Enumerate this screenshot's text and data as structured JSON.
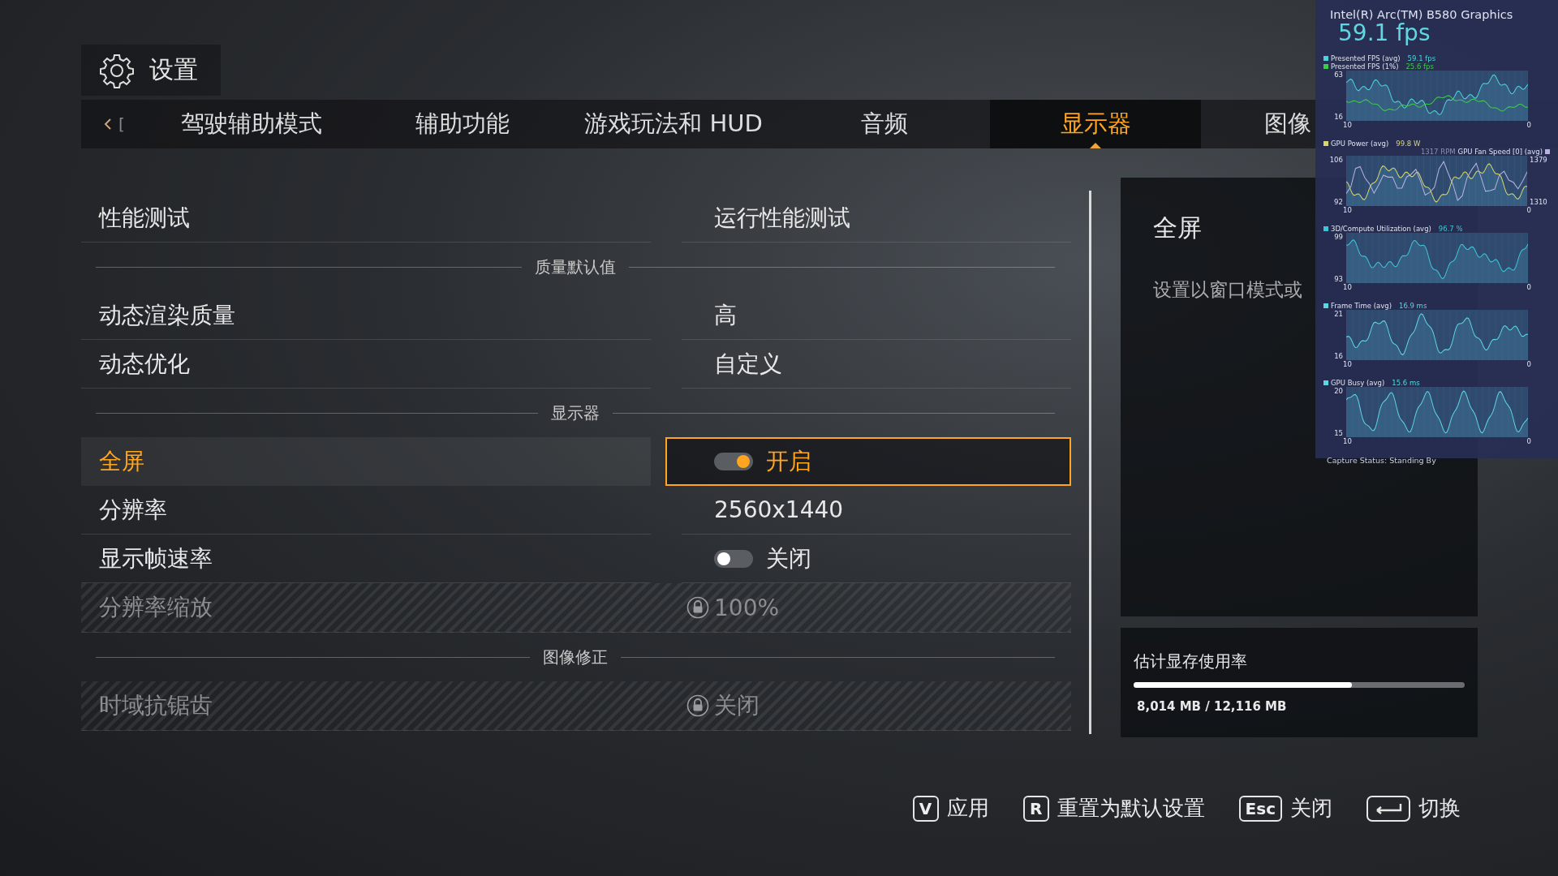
{
  "header": {
    "title": "设置"
  },
  "tabs": {
    "bumper": "[",
    "items": [
      {
        "label": "驾驶辅助模式",
        "selected": false
      },
      {
        "label": "辅助功能",
        "selected": false
      },
      {
        "label": "游戏玩法和 HUD",
        "selected": false
      },
      {
        "label": "音频",
        "selected": false
      },
      {
        "label": "显示器",
        "selected": true
      },
      {
        "label": "图像",
        "selected": false
      }
    ]
  },
  "settings": [
    {
      "kind": "text",
      "label": "性能测试",
      "value": "运行性能测试",
      "selected": false
    },
    {
      "kind": "section",
      "label": "质量默认值"
    },
    {
      "kind": "text",
      "label": "动态渲染质量",
      "value": "高",
      "selected": false
    },
    {
      "kind": "text",
      "label": "动态优化",
      "value": "自定义",
      "selected": false
    },
    {
      "kind": "section",
      "label": "显示器"
    },
    {
      "kind": "toggle",
      "label": "全屏",
      "value": "开启",
      "on": true,
      "selected": true
    },
    {
      "kind": "text",
      "label": "分辨率",
      "value": "2560x1440",
      "selected": false
    },
    {
      "kind": "toggle",
      "label": "显示帧速率",
      "value": "关闭",
      "on": false,
      "selected": false
    },
    {
      "kind": "locked",
      "label": "分辨率缩放",
      "value": "100%",
      "selected": false
    },
    {
      "kind": "section",
      "label": "图像修正"
    },
    {
      "kind": "locked",
      "label": "时域抗锯齿",
      "value": "关闭",
      "selected": false
    }
  ],
  "info_panel": {
    "title": "全屏",
    "description": "设置以窗口模式或"
  },
  "vram": {
    "label": "估计显存使用率",
    "level": 0.66,
    "reading": "8,014 MB / 12,116 MB"
  },
  "hints": [
    {
      "kind": "letter",
      "key": "V",
      "label": "应用"
    },
    {
      "kind": "letter",
      "key": "R",
      "label": "重置为默认设置"
    },
    {
      "kind": "letter",
      "key": "Esc",
      "label": "关闭"
    },
    {
      "kind": "enter",
      "label": "切换"
    }
  ],
  "overlay": {
    "gpu": "Intel(R) Arc(TM) B580 Graphics",
    "fps": "59.1 fps",
    "graphs": [
      {
        "legends": [
          {
            "name": "Presented FPS (avg)",
            "value": "59.1 fps",
            "color": "#4fd1d9"
          },
          {
            "name": "Presented FPS (1%)",
            "value": "25.6 fps",
            "color": "#3ec94a"
          }
        ],
        "y_ticks": [
          "63",
          "16"
        ],
        "x_ticks": [
          "10",
          "0"
        ]
      },
      {
        "legends": [
          {
            "name": "GPU Power (avg)",
            "value": "99.8 W",
            "color": "#d8d66c"
          }
        ],
        "right_legend": {
          "name": "GPU Fan Speed [0] (avg)",
          "value": "1317 RPM",
          "color": "#b9b2e0"
        },
        "y_ticks": [
          "106",
          "92"
        ],
        "right_ticks": [
          "1379",
          "1310"
        ],
        "x_ticks": [
          "10",
          "0"
        ]
      },
      {
        "legends": [
          {
            "name": "3D/Compute Utilization (avg)",
            "value": "96.7 %",
            "color": "#3fc4d6"
          }
        ],
        "y_ticks": [
          "99",
          "93"
        ],
        "x_ticks": [
          "10",
          "0"
        ]
      },
      {
        "legends": [
          {
            "name": "Frame Time (avg)",
            "value": "16.9 ms",
            "color": "#5ed6e0"
          }
        ],
        "y_ticks": [
          "21",
          "16"
        ],
        "x_ticks": [
          "10",
          "0"
        ]
      },
      {
        "legends": [
          {
            "name": "GPU Busy (avg)",
            "value": "15.6 ms",
            "color": "#5ed6e0"
          }
        ],
        "y_ticks": [
          "20",
          "15"
        ],
        "x_ticks": [
          "10",
          "0"
        ]
      }
    ],
    "status": "Capture Status: Standing By"
  }
}
